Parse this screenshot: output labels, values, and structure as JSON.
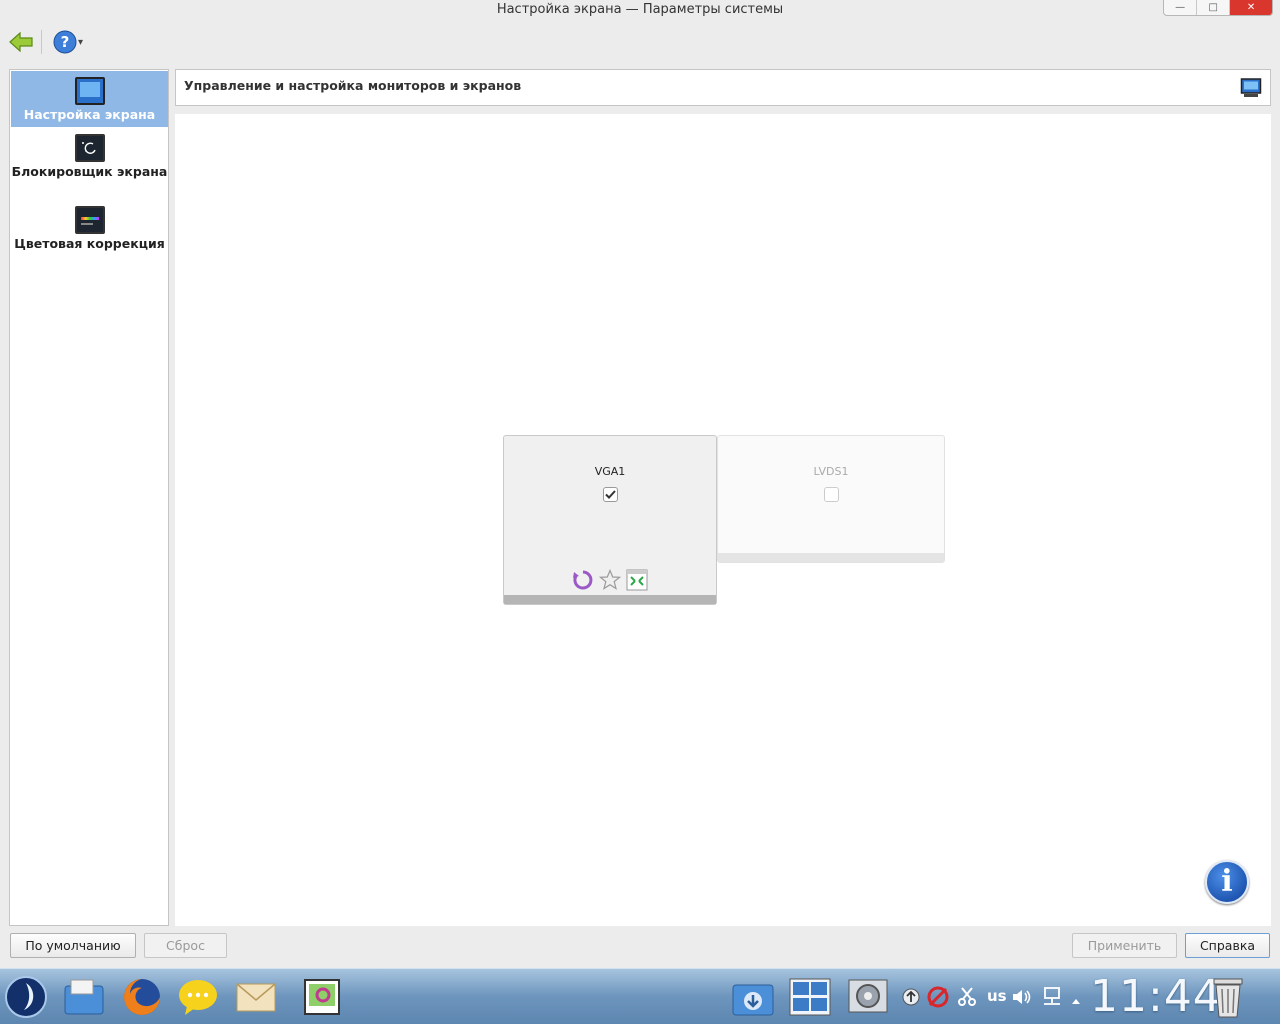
{
  "window": {
    "title": "Настройка экрана — Параметры системы",
    "controls": {
      "minimize": "—",
      "maximize": "□",
      "close": "✕"
    }
  },
  "toolbar": {
    "back_icon": "back-arrow-icon",
    "help_icon": "help-icon",
    "help_menu_arrow": "▾"
  },
  "sidebar": {
    "items": [
      {
        "label": "Настройка экрана",
        "icon": "monitor-icon",
        "selected": true
      },
      {
        "label": "Блокировщик экрана",
        "icon": "screen-locker-icon",
        "selected": false
      },
      {
        "label": "Цветовая коррекция",
        "icon": "color-correction-icon",
        "selected": false
      }
    ]
  },
  "header": {
    "title": "Управление и настройка мониторов и экранов",
    "icon": "display-settings-icon"
  },
  "outputs": [
    {
      "name": "VGA1",
      "enabled": true,
      "primary": false
    },
    {
      "name": "LVDS1",
      "enabled": false,
      "primary": false
    }
  ],
  "buttons": {
    "defaults": "По умолчанию",
    "reset": "Сброс",
    "apply": "Применить",
    "help": "Справка"
  },
  "taskbar": {
    "clock": "11:44",
    "keyboard_layout": "us",
    "apps": [
      "app-launcher-icon",
      "file-manager-icon",
      "firefox-icon",
      "messenger-icon",
      "mail-icon",
      "image-viewer-icon"
    ],
    "tray": [
      "downloads-icon",
      "desktop-grid-icon",
      "system-settings-icon",
      "updates-icon",
      "no-sync-icon",
      "scissors-icon",
      "volume-icon",
      "network-icon",
      "tray-expand-icon",
      "trash-icon"
    ]
  },
  "colors": {
    "selection": "#8fb8e6",
    "taskbar": "#6d95bd",
    "info_button": "#1a56c0"
  }
}
